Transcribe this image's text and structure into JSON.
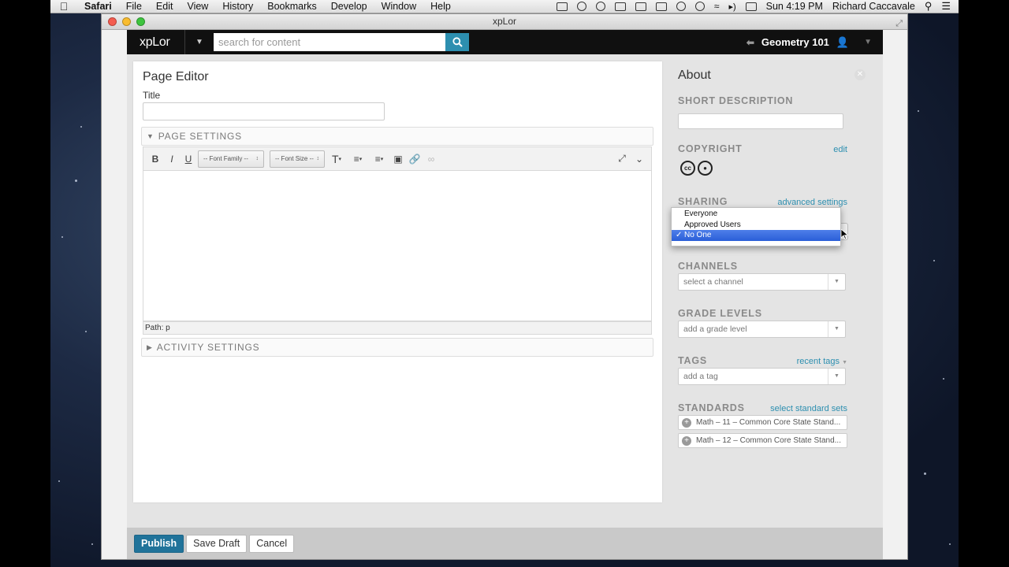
{
  "menubar": {
    "app_name": "Safari",
    "items": [
      "File",
      "Edit",
      "View",
      "History",
      "Bookmarks",
      "Develop",
      "Window",
      "Help"
    ],
    "clock": "Sun 4:19 PM",
    "user": "Richard Caccavale"
  },
  "window": {
    "title": "xpLor"
  },
  "topnav": {
    "logo": "xpLor",
    "search_placeholder": "search for content",
    "course_title": "Geometry 101"
  },
  "editor": {
    "heading": "Page Editor",
    "title_label": "Title",
    "title_value": "",
    "page_settings_label": "PAGE SETTINGS",
    "activity_settings_label": "ACTIVITY SETTINGS",
    "font_family_label": "-- Font Family --",
    "font_size_label": "-- Font Size --",
    "path_label": "Path: p"
  },
  "about": {
    "heading": "About",
    "short_description_label": "SHORT DESCRIPTION",
    "copyright_label": "COPYRIGHT",
    "copyright_edit": "edit",
    "license_icons": [
      "cc",
      "by"
    ],
    "sharing_label": "SHARING",
    "sharing_advanced": "advanced settings",
    "sharing_options": [
      "Everyone",
      "Approved Users",
      "No One"
    ],
    "sharing_selected": "No One",
    "channels_label": "CHANNELS",
    "channels_placeholder": "select a channel",
    "grade_levels_label": "GRADE LEVELS",
    "grade_levels_placeholder": "add a grade level",
    "tags_label": "TAGS",
    "tags_recent": "recent tags",
    "tags_placeholder": "add a tag",
    "standards_label": "STANDARDS",
    "standards_select": "select standard sets",
    "standards": [
      "Math – 11 – Common Core State Stand...",
      "Math – 12 – Common Core State Stand..."
    ]
  },
  "actions": {
    "publish": "Publish",
    "save_draft": "Save Draft",
    "cancel": "Cancel"
  },
  "colors": {
    "accent": "#2d8fb0",
    "publish": "#20739a",
    "nav_bg": "#101010",
    "selection": "#2a5ed8"
  }
}
